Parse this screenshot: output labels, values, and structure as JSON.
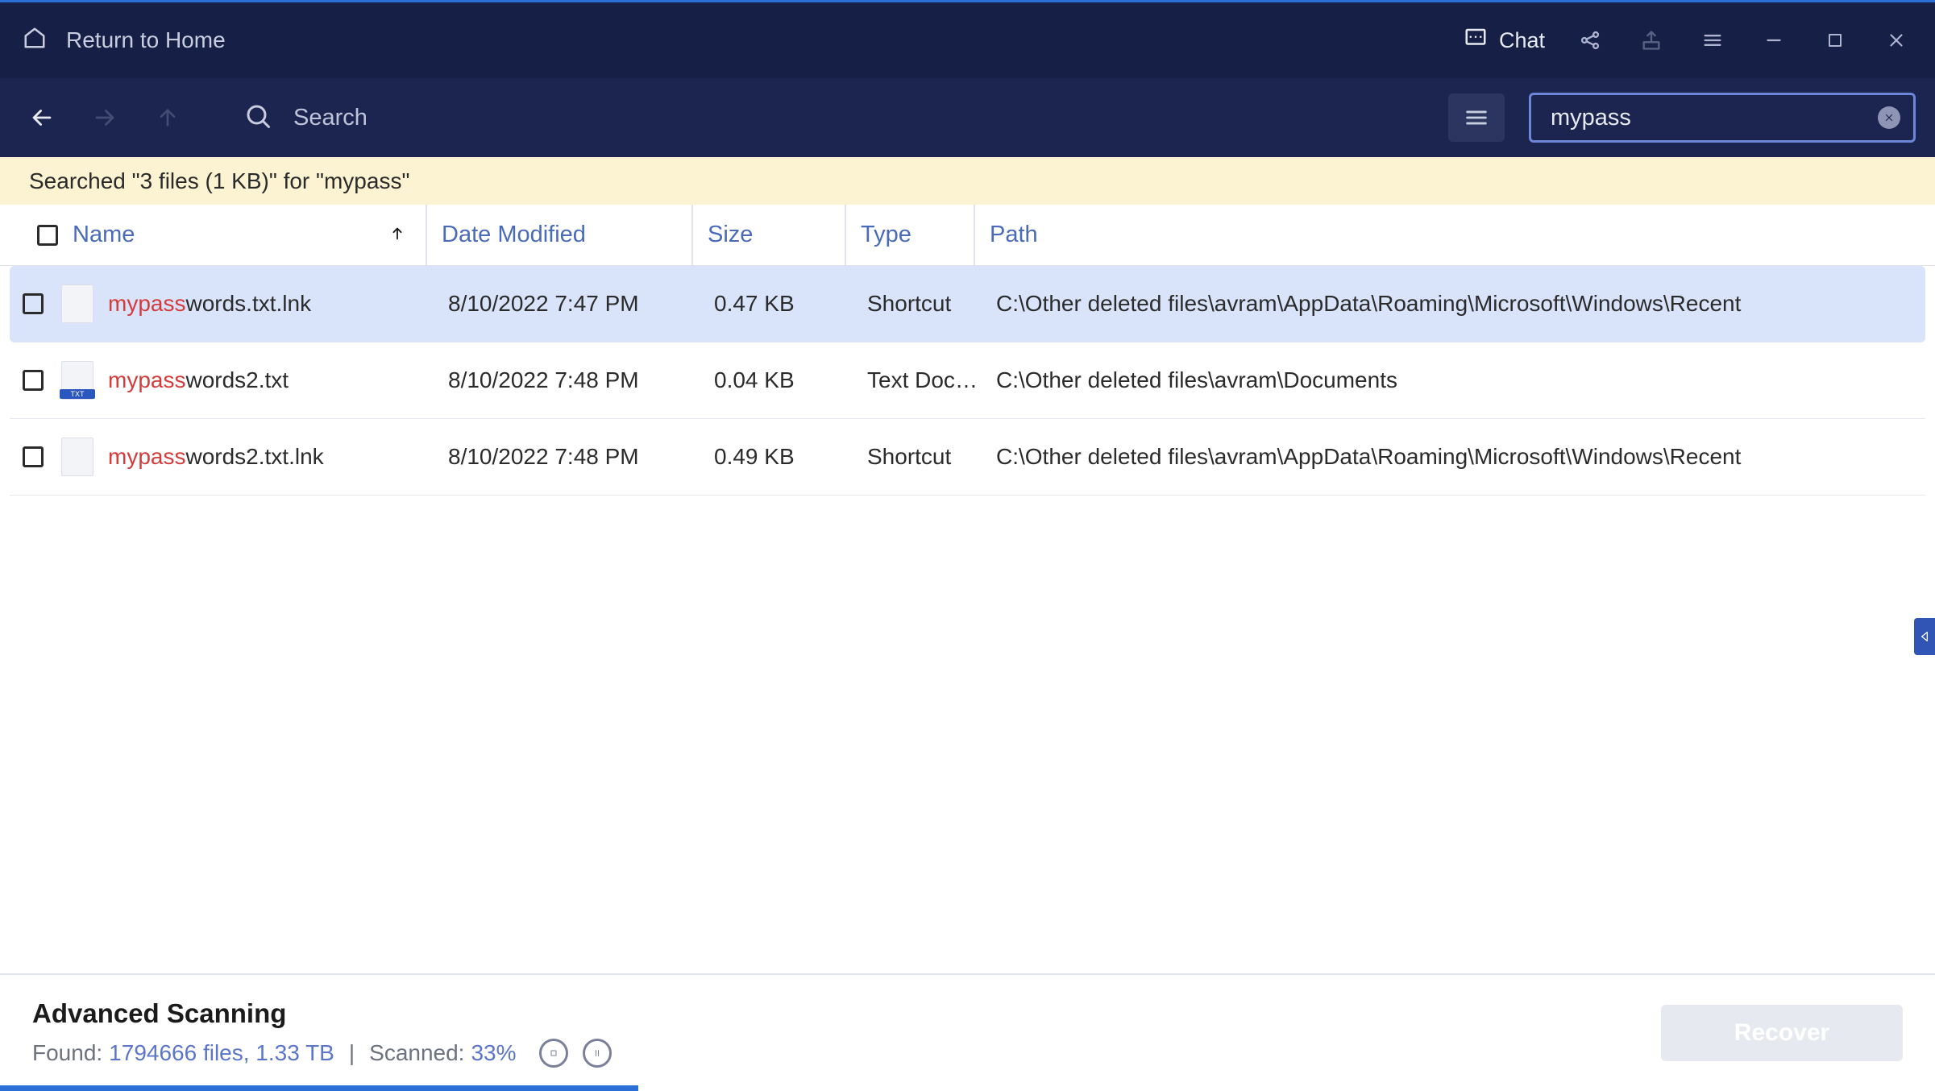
{
  "titlebar": {
    "home_label": "Return to Home",
    "chat_label": "Chat"
  },
  "toolbar": {
    "search_label": "Search",
    "search_value": "mypass"
  },
  "info_strip": {
    "text": "Searched \"3 files (1 KB)\" for \"mypass\""
  },
  "columns": {
    "name": "Name",
    "date": "Date Modified",
    "size": "Size",
    "type": "Type",
    "path": "Path"
  },
  "search_highlight": "mypass",
  "rows": [
    {
      "name_hl": "mypass",
      "name_rest": "words.txt.lnk",
      "date": "8/10/2022 7:47 PM",
      "size": "0.47 KB",
      "type": "Shortcut",
      "path": "C:\\Other deleted files\\avram\\AppData\\Roaming\\Microsoft\\Windows\\Recent",
      "icon_kind": "blank",
      "selected": true
    },
    {
      "name_hl": "mypass",
      "name_rest": "words2.txt",
      "date": "8/10/2022 7:48 PM",
      "size": "0.04 KB",
      "type": "Text Docu...",
      "path": "C:\\Other deleted files\\avram\\Documents",
      "icon_kind": "txt",
      "selected": false
    },
    {
      "name_hl": "mypass",
      "name_rest": "words2.txt.lnk",
      "date": "8/10/2022 7:48 PM",
      "size": "0.49 KB",
      "type": "Shortcut",
      "path": "C:\\Other deleted files\\avram\\AppData\\Roaming\\Microsoft\\Windows\\Recent",
      "icon_kind": "blank",
      "selected": false
    }
  ],
  "footer": {
    "title": "Advanced Scanning",
    "found_label": "Found:",
    "found_value": "1794666 files, 1.33 TB",
    "scanned_label": "Scanned:",
    "scanned_value": "33%",
    "recover_label": "Recover",
    "progress_pct": 33
  }
}
